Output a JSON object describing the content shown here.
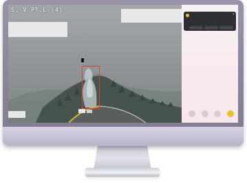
{
  "monitor": {
    "video_feed": {
      "osd_text": "S. V PT.L (4)",
      "detection_label": "",
      "detection_box_color": "#e0403a"
    },
    "alert_panel": {
      "status_bar": {
        "time": "",
        "icons": ""
      },
      "notification": {
        "title": "",
        "lines": [
          "",
          ""
        ],
        "actions": [
          "",
          "",
          ""
        ],
        "icon_color": "#f2c230"
      },
      "nav_buttons": [
        {
          "icon": "circle-icon",
          "active": false
        },
        {
          "icon": "circle-icon",
          "active": false
        },
        {
          "icon": "circle-icon",
          "active": false
        },
        {
          "icon": "circle-icon",
          "active": true
        }
      ]
    }
  }
}
